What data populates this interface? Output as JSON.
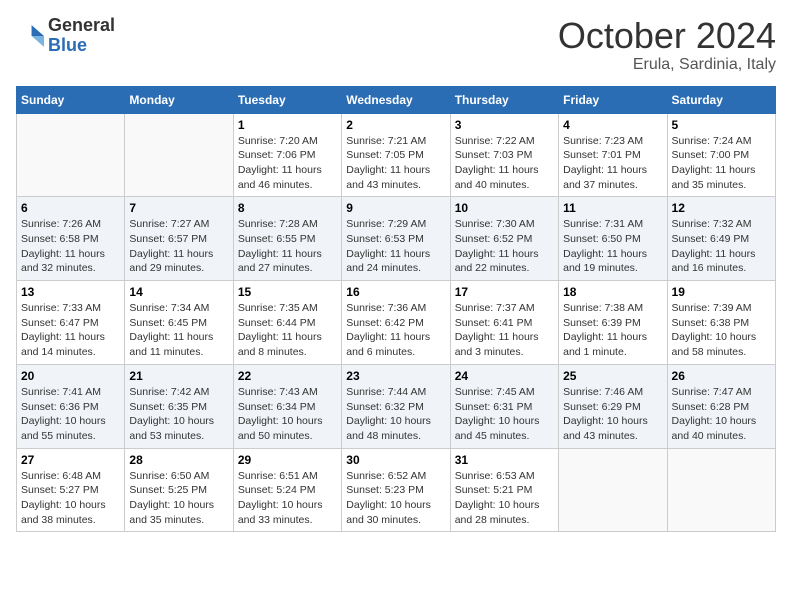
{
  "header": {
    "logo_general": "General",
    "logo_blue": "Blue",
    "month_title": "October 2024",
    "location": "Erula, Sardinia, Italy"
  },
  "calendar": {
    "days_of_week": [
      "Sunday",
      "Monday",
      "Tuesday",
      "Wednesday",
      "Thursday",
      "Friday",
      "Saturday"
    ],
    "weeks": [
      [
        {
          "day": "",
          "content": ""
        },
        {
          "day": "",
          "content": ""
        },
        {
          "day": "1",
          "content": "Sunrise: 7:20 AM\nSunset: 7:06 PM\nDaylight: 11 hours and 46 minutes."
        },
        {
          "day": "2",
          "content": "Sunrise: 7:21 AM\nSunset: 7:05 PM\nDaylight: 11 hours and 43 minutes."
        },
        {
          "day": "3",
          "content": "Sunrise: 7:22 AM\nSunset: 7:03 PM\nDaylight: 11 hours and 40 minutes."
        },
        {
          "day": "4",
          "content": "Sunrise: 7:23 AM\nSunset: 7:01 PM\nDaylight: 11 hours and 37 minutes."
        },
        {
          "day": "5",
          "content": "Sunrise: 7:24 AM\nSunset: 7:00 PM\nDaylight: 11 hours and 35 minutes."
        }
      ],
      [
        {
          "day": "6",
          "content": "Sunrise: 7:26 AM\nSunset: 6:58 PM\nDaylight: 11 hours and 32 minutes."
        },
        {
          "day": "7",
          "content": "Sunrise: 7:27 AM\nSunset: 6:57 PM\nDaylight: 11 hours and 29 minutes."
        },
        {
          "day": "8",
          "content": "Sunrise: 7:28 AM\nSunset: 6:55 PM\nDaylight: 11 hours and 27 minutes."
        },
        {
          "day": "9",
          "content": "Sunrise: 7:29 AM\nSunset: 6:53 PM\nDaylight: 11 hours and 24 minutes."
        },
        {
          "day": "10",
          "content": "Sunrise: 7:30 AM\nSunset: 6:52 PM\nDaylight: 11 hours and 22 minutes."
        },
        {
          "day": "11",
          "content": "Sunrise: 7:31 AM\nSunset: 6:50 PM\nDaylight: 11 hours and 19 minutes."
        },
        {
          "day": "12",
          "content": "Sunrise: 7:32 AM\nSunset: 6:49 PM\nDaylight: 11 hours and 16 minutes."
        }
      ],
      [
        {
          "day": "13",
          "content": "Sunrise: 7:33 AM\nSunset: 6:47 PM\nDaylight: 11 hours and 14 minutes."
        },
        {
          "day": "14",
          "content": "Sunrise: 7:34 AM\nSunset: 6:45 PM\nDaylight: 11 hours and 11 minutes."
        },
        {
          "day": "15",
          "content": "Sunrise: 7:35 AM\nSunset: 6:44 PM\nDaylight: 11 hours and 8 minutes."
        },
        {
          "day": "16",
          "content": "Sunrise: 7:36 AM\nSunset: 6:42 PM\nDaylight: 11 hours and 6 minutes."
        },
        {
          "day": "17",
          "content": "Sunrise: 7:37 AM\nSunset: 6:41 PM\nDaylight: 11 hours and 3 minutes."
        },
        {
          "day": "18",
          "content": "Sunrise: 7:38 AM\nSunset: 6:39 PM\nDaylight: 11 hours and 1 minute."
        },
        {
          "day": "19",
          "content": "Sunrise: 7:39 AM\nSunset: 6:38 PM\nDaylight: 10 hours and 58 minutes."
        }
      ],
      [
        {
          "day": "20",
          "content": "Sunrise: 7:41 AM\nSunset: 6:36 PM\nDaylight: 10 hours and 55 minutes."
        },
        {
          "day": "21",
          "content": "Sunrise: 7:42 AM\nSunset: 6:35 PM\nDaylight: 10 hours and 53 minutes."
        },
        {
          "day": "22",
          "content": "Sunrise: 7:43 AM\nSunset: 6:34 PM\nDaylight: 10 hours and 50 minutes."
        },
        {
          "day": "23",
          "content": "Sunrise: 7:44 AM\nSunset: 6:32 PM\nDaylight: 10 hours and 48 minutes."
        },
        {
          "day": "24",
          "content": "Sunrise: 7:45 AM\nSunset: 6:31 PM\nDaylight: 10 hours and 45 minutes."
        },
        {
          "day": "25",
          "content": "Sunrise: 7:46 AM\nSunset: 6:29 PM\nDaylight: 10 hours and 43 minutes."
        },
        {
          "day": "26",
          "content": "Sunrise: 7:47 AM\nSunset: 6:28 PM\nDaylight: 10 hours and 40 minutes."
        }
      ],
      [
        {
          "day": "27",
          "content": "Sunrise: 6:48 AM\nSunset: 5:27 PM\nDaylight: 10 hours and 38 minutes."
        },
        {
          "day": "28",
          "content": "Sunrise: 6:50 AM\nSunset: 5:25 PM\nDaylight: 10 hours and 35 minutes."
        },
        {
          "day": "29",
          "content": "Sunrise: 6:51 AM\nSunset: 5:24 PM\nDaylight: 10 hours and 33 minutes."
        },
        {
          "day": "30",
          "content": "Sunrise: 6:52 AM\nSunset: 5:23 PM\nDaylight: 10 hours and 30 minutes."
        },
        {
          "day": "31",
          "content": "Sunrise: 6:53 AM\nSunset: 5:21 PM\nDaylight: 10 hours and 28 minutes."
        },
        {
          "day": "",
          "content": ""
        },
        {
          "day": "",
          "content": ""
        }
      ]
    ]
  }
}
